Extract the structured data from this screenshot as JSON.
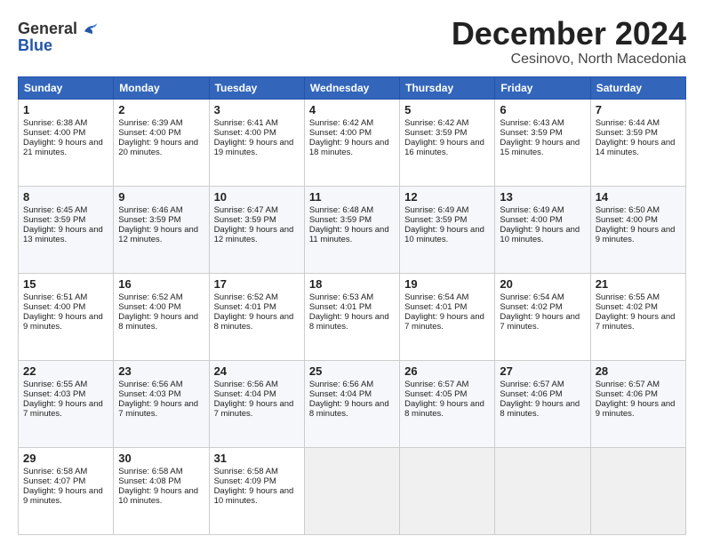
{
  "header": {
    "logo_general": "General",
    "logo_blue": "Blue",
    "month": "December 2024",
    "location": "Cesinovo, North Macedonia"
  },
  "weekdays": [
    "Sunday",
    "Monday",
    "Tuesday",
    "Wednesday",
    "Thursday",
    "Friday",
    "Saturday"
  ],
  "weeks": [
    [
      {
        "day": "1",
        "sunrise": "6:38 AM",
        "sunset": "4:00 PM",
        "daylight": "9 hours and 21 minutes."
      },
      {
        "day": "2",
        "sunrise": "6:39 AM",
        "sunset": "4:00 PM",
        "daylight": "9 hours and 20 minutes."
      },
      {
        "day": "3",
        "sunrise": "6:41 AM",
        "sunset": "4:00 PM",
        "daylight": "9 hours and 19 minutes."
      },
      {
        "day": "4",
        "sunrise": "6:42 AM",
        "sunset": "4:00 PM",
        "daylight": "9 hours and 18 minutes."
      },
      {
        "day": "5",
        "sunrise": "6:42 AM",
        "sunset": "3:59 PM",
        "daylight": "9 hours and 16 minutes."
      },
      {
        "day": "6",
        "sunrise": "6:43 AM",
        "sunset": "3:59 PM",
        "daylight": "9 hours and 15 minutes."
      },
      {
        "day": "7",
        "sunrise": "6:44 AM",
        "sunset": "3:59 PM",
        "daylight": "9 hours and 14 minutes."
      }
    ],
    [
      {
        "day": "8",
        "sunrise": "6:45 AM",
        "sunset": "3:59 PM",
        "daylight": "9 hours and 13 minutes."
      },
      {
        "day": "9",
        "sunrise": "6:46 AM",
        "sunset": "3:59 PM",
        "daylight": "9 hours and 12 minutes."
      },
      {
        "day": "10",
        "sunrise": "6:47 AM",
        "sunset": "3:59 PM",
        "daylight": "9 hours and 12 minutes."
      },
      {
        "day": "11",
        "sunrise": "6:48 AM",
        "sunset": "3:59 PM",
        "daylight": "9 hours and 11 minutes."
      },
      {
        "day": "12",
        "sunrise": "6:49 AM",
        "sunset": "3:59 PM",
        "daylight": "9 hours and 10 minutes."
      },
      {
        "day": "13",
        "sunrise": "6:49 AM",
        "sunset": "4:00 PM",
        "daylight": "9 hours and 10 minutes."
      },
      {
        "day": "14",
        "sunrise": "6:50 AM",
        "sunset": "4:00 PM",
        "daylight": "9 hours and 9 minutes."
      }
    ],
    [
      {
        "day": "15",
        "sunrise": "6:51 AM",
        "sunset": "4:00 PM",
        "daylight": "9 hours and 9 minutes."
      },
      {
        "day": "16",
        "sunrise": "6:52 AM",
        "sunset": "4:00 PM",
        "daylight": "9 hours and 8 minutes."
      },
      {
        "day": "17",
        "sunrise": "6:52 AM",
        "sunset": "4:01 PM",
        "daylight": "9 hours and 8 minutes."
      },
      {
        "day": "18",
        "sunrise": "6:53 AM",
        "sunset": "4:01 PM",
        "daylight": "9 hours and 8 minutes."
      },
      {
        "day": "19",
        "sunrise": "6:54 AM",
        "sunset": "4:01 PM",
        "daylight": "9 hours and 7 minutes."
      },
      {
        "day": "20",
        "sunrise": "6:54 AM",
        "sunset": "4:02 PM",
        "daylight": "9 hours and 7 minutes."
      },
      {
        "day": "21",
        "sunrise": "6:55 AM",
        "sunset": "4:02 PM",
        "daylight": "9 hours and 7 minutes."
      }
    ],
    [
      {
        "day": "22",
        "sunrise": "6:55 AM",
        "sunset": "4:03 PM",
        "daylight": "9 hours and 7 minutes."
      },
      {
        "day": "23",
        "sunrise": "6:56 AM",
        "sunset": "4:03 PM",
        "daylight": "9 hours and 7 minutes."
      },
      {
        "day": "24",
        "sunrise": "6:56 AM",
        "sunset": "4:04 PM",
        "daylight": "9 hours and 7 minutes."
      },
      {
        "day": "25",
        "sunrise": "6:56 AM",
        "sunset": "4:04 PM",
        "daylight": "9 hours and 8 minutes."
      },
      {
        "day": "26",
        "sunrise": "6:57 AM",
        "sunset": "4:05 PM",
        "daylight": "9 hours and 8 minutes."
      },
      {
        "day": "27",
        "sunrise": "6:57 AM",
        "sunset": "4:06 PM",
        "daylight": "9 hours and 8 minutes."
      },
      {
        "day": "28",
        "sunrise": "6:57 AM",
        "sunset": "4:06 PM",
        "daylight": "9 hours and 9 minutes."
      }
    ],
    [
      {
        "day": "29",
        "sunrise": "6:58 AM",
        "sunset": "4:07 PM",
        "daylight": "9 hours and 9 minutes."
      },
      {
        "day": "30",
        "sunrise": "6:58 AM",
        "sunset": "4:08 PM",
        "daylight": "9 hours and 10 minutes."
      },
      {
        "day": "31",
        "sunrise": "6:58 AM",
        "sunset": "4:09 PM",
        "daylight": "9 hours and 10 minutes."
      },
      null,
      null,
      null,
      null
    ]
  ]
}
